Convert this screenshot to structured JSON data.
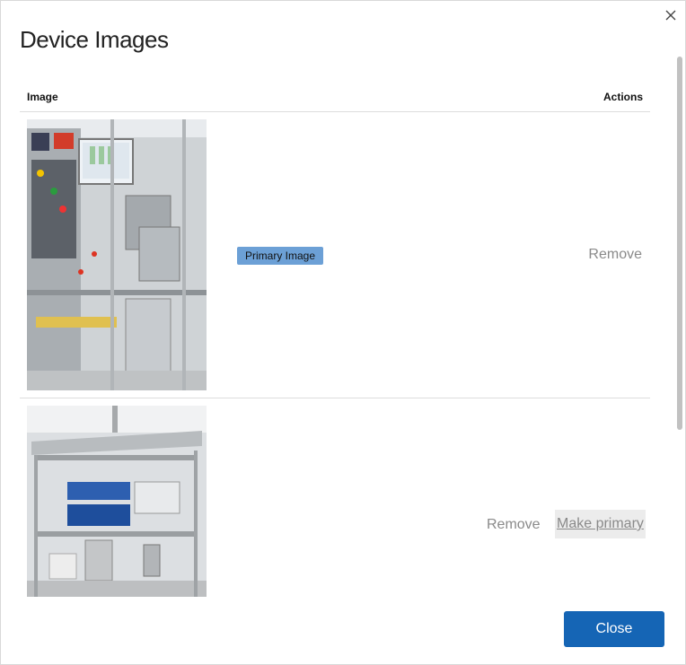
{
  "dialog": {
    "title": "Device Images",
    "close_icon": "close-icon",
    "close_button_label": "Close"
  },
  "table": {
    "headers": {
      "image": "Image",
      "actions": "Actions"
    },
    "rows": [
      {
        "primary_badge": "Primary Image",
        "remove_label": "Remove"
      },
      {
        "remove_label": "Remove",
        "make_primary_label": "Make primary"
      }
    ]
  },
  "colors": {
    "accent": "#1565b5",
    "badge": "#6ca0d6",
    "link": "#8a8a8a"
  }
}
